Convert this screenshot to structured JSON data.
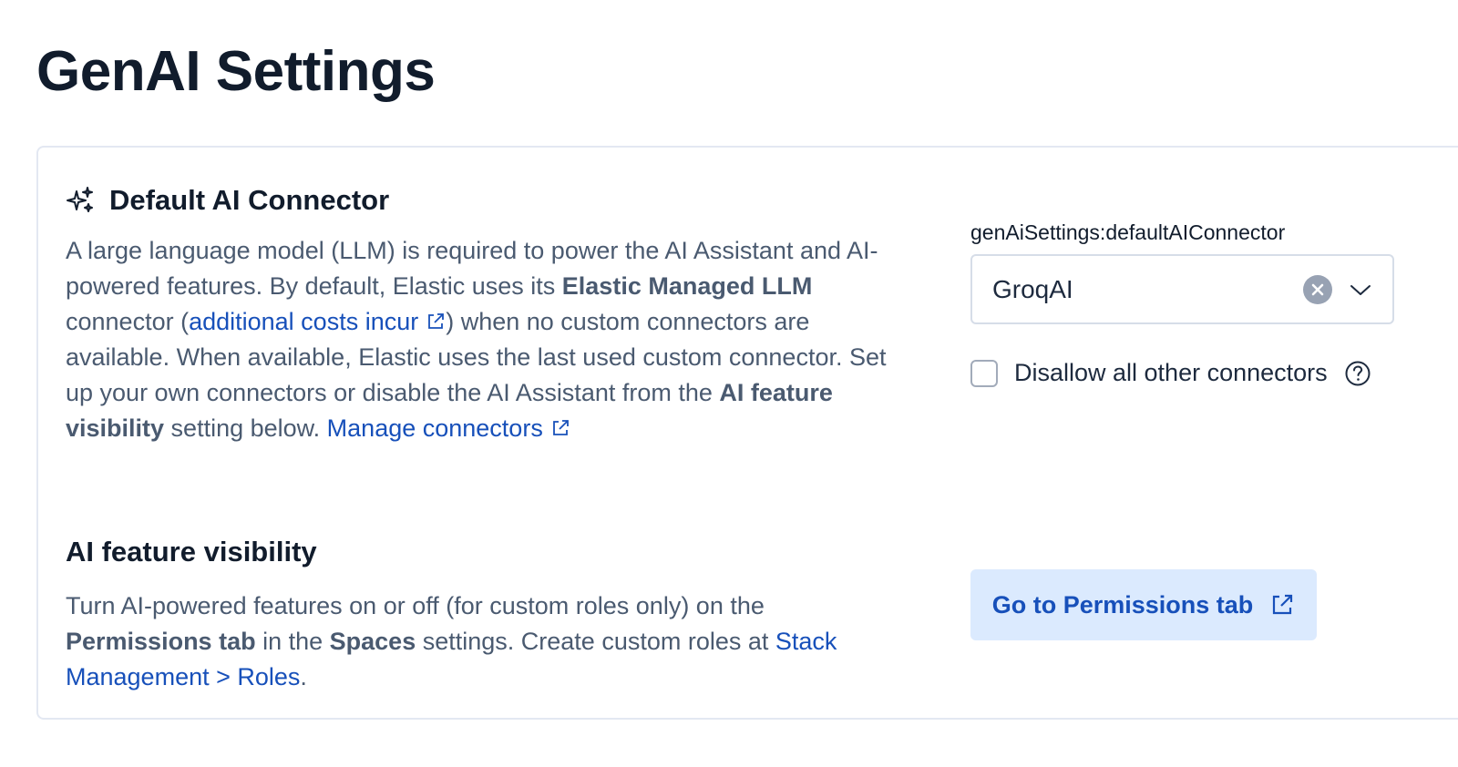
{
  "page": {
    "title": "GenAI Settings"
  },
  "default_connector": {
    "title": "Default AI Connector",
    "icon": "sparkles-icon",
    "desc_part1": "A large language model (LLM) is required to power the AI Assistant and AI-powered features. By default, Elastic uses its ",
    "desc_bold1": "Elastic Managed LLM",
    "desc_part2": " connector (",
    "desc_link1": "additional costs incur",
    "desc_part3": ") when no custom connectors are available. When available, Elastic uses the last used custom connector. Set up your own connectors or disable the AI Assistant from the ",
    "desc_bold2": "AI feature visibility",
    "desc_part4": " setting below. ",
    "desc_link2": "Manage connectors",
    "field_label": "genAiSettings:defaultAIConnector",
    "selected_value": "GroqAI",
    "checkbox_label": "Disallow all other connectors",
    "checkbox_checked": false
  },
  "feature_visibility": {
    "title": "AI feature visibility",
    "desc_part1": "Turn AI-powered features on or off (for custom roles only) on the ",
    "desc_bold1": "Permissions tab",
    "desc_part2": " in the ",
    "desc_bold2": "Spaces",
    "desc_part3": " settings. Create custom roles at ",
    "desc_link1": "Stack Management > Roles",
    "desc_part4": ".",
    "button_label": "Go to Permissions tab"
  },
  "colors": {
    "link": "#1750ba",
    "button_bg": "#dbeafe",
    "text_primary": "#111c2c",
    "text_secondary": "#4a5a70"
  }
}
